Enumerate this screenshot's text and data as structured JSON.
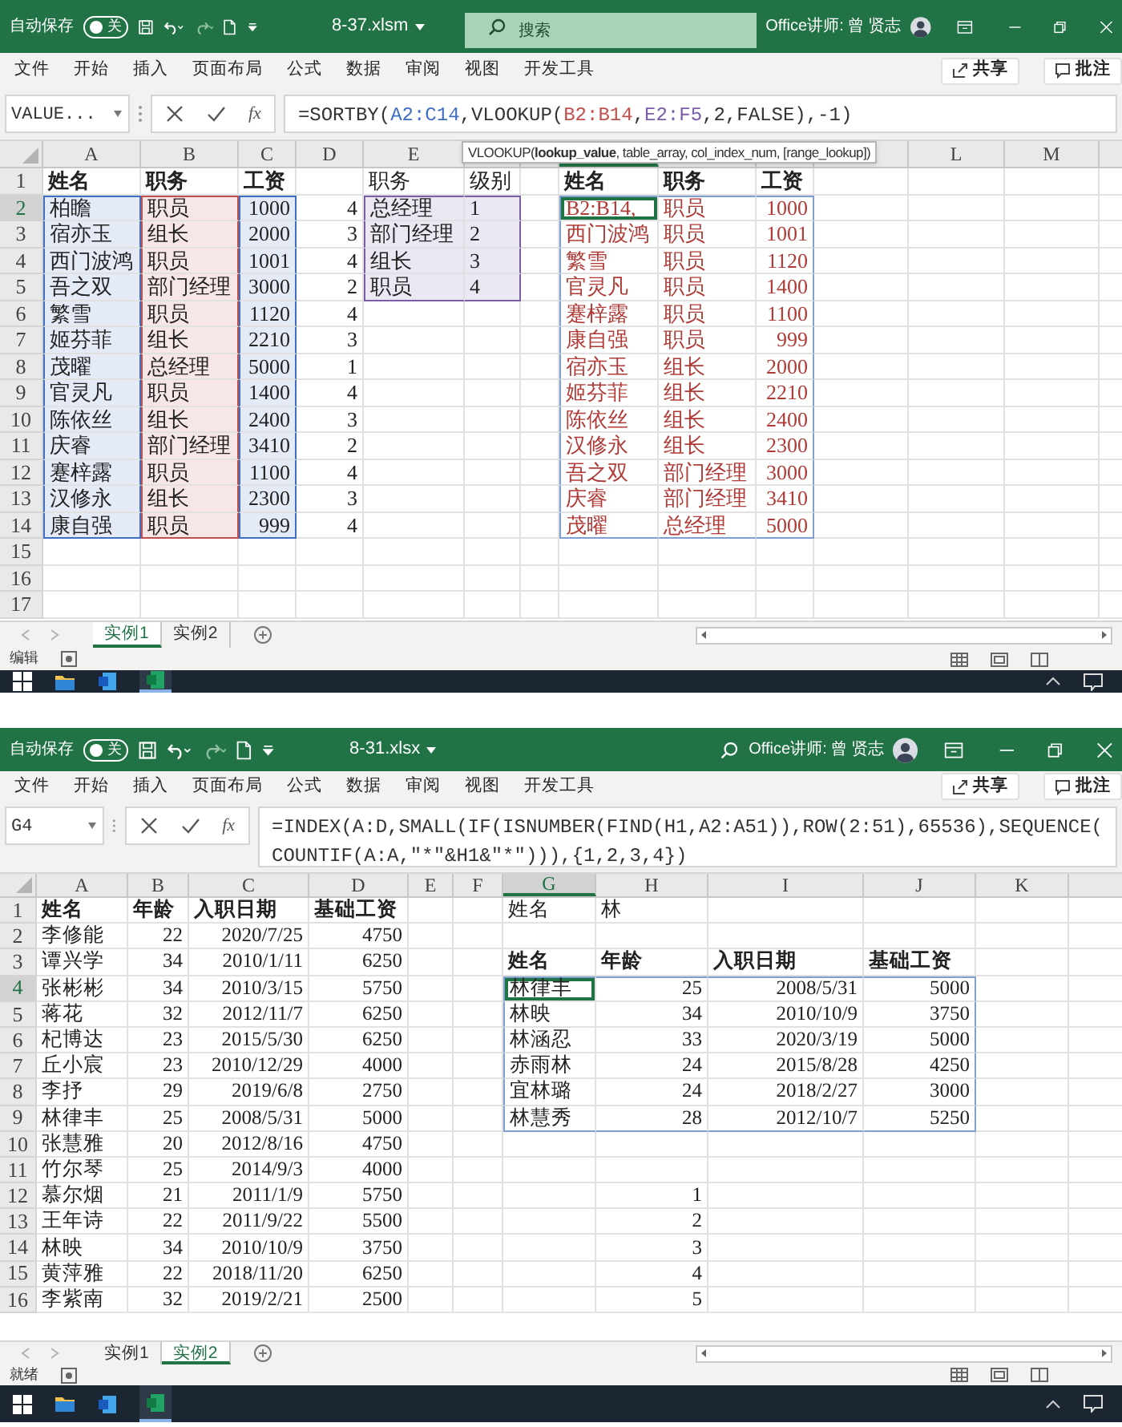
{
  "screens": [
    {
      "title_bar": {
        "autosave": "自动保存",
        "autosave_toggle": {
          "label": "关",
          "on": false
        },
        "filename": "8-37.xlsm",
        "search": {
          "placeholder": "搜索"
        },
        "user": "Office讲师: 曾 贤志"
      },
      "menu": [
        "文件",
        "开始",
        "插入",
        "页面布局",
        "公式",
        "数据",
        "审阅",
        "视图",
        "开发工具"
      ],
      "share": "共享",
      "comments": "批注",
      "name_box": "VALUE...",
      "insert_function": "fx",
      "formula_lines": [
        [
          {
            "text": "=SORTBY("
          },
          {
            "text": "A2:C14",
            "color": "#3f6fc0"
          },
          {
            "text": ",VLOOKUP("
          },
          {
            "text": "B2:B14",
            "color": "#c0504d"
          },
          {
            "text": ","
          },
          {
            "text": "E2:F5",
            "color": "#7b5ea7"
          },
          {
            "text": ",2,FALSE),-1)"
          }
        ]
      ],
      "tooltip": "VLOOKUP(**lookup_value**, table_array, col_index_num, [range_lookup])",
      "columns": [
        "A",
        "B",
        "C",
        "D",
        "E",
        null,
        null,
        null,
        null,
        null,
        null,
        "L",
        "M"
      ],
      "rows": [
        {
          "number": "1",
          "cells": [
            {
              "text": "姓名",
              "kind": "plain",
              "bold": true
            },
            {
              "text": "职务",
              "kind": "plain",
              "bold": true
            },
            {
              "text": "工资",
              "kind": "plain",
              "bold": true
            },
            null,
            {
              "text": "职务",
              "kind": "plain"
            },
            {
              "text": "级别",
              "kind": "plain"
            },
            null,
            {
              "text": "姓名",
              "kind": "plain",
              "bold": true
            },
            {
              "text": "职务",
              "kind": "plain",
              "bold": true
            },
            {
              "text": "工资",
              "kind": "plain",
              "bold": true
            }
          ]
        },
        {
          "number": "2",
          "cells": [
            {
              "text": "柏瞻",
              "kind": "reference",
              "color": "#3f6fc0"
            },
            {
              "text": "职员",
              "kind": "reference",
              "color": "#c0504d"
            },
            {
              "text": "1000",
              "kind": "reference",
              "color": "#3f6fc0",
              "number": true
            },
            {
              "text": "4",
              "kind": "plain",
              "number": true
            },
            {
              "text": "总经理",
              "kind": "reference",
              "color": "#7b5ea7"
            },
            {
              "text": "1",
              "kind": "reference",
              "color": "#7b5ea7"
            },
            null,
            {
              "text": "B2:B14,",
              "kind": "spill",
              "color": "#b03a36",
              "active": true
            },
            {
              "text": "职员",
              "kind": "spill",
              "color": "#b03a36"
            },
            {
              "text": "1000",
              "kind": "spill",
              "color": "#b03a36",
              "number": true
            }
          ]
        },
        {
          "number": "3",
          "cells": [
            {
              "text": "宿亦玉",
              "kind": "reference",
              "color": "#3f6fc0"
            },
            {
              "text": "组长",
              "kind": "reference",
              "color": "#c0504d"
            },
            {
              "text": "2000",
              "kind": "reference",
              "color": "#3f6fc0",
              "number": true
            },
            {
              "text": "3",
              "kind": "plain",
              "number": true
            },
            {
              "text": "部门经理",
              "kind": "reference",
              "color": "#7b5ea7"
            },
            {
              "text": "2",
              "kind": "reference",
              "color": "#7b5ea7"
            },
            null,
            {
              "text": "西门波鸿",
              "kind": "spill",
              "color": "#b03a36"
            },
            {
              "text": "职员",
              "kind": "spill",
              "color": "#b03a36"
            },
            {
              "text": "1001",
              "kind": "spill",
              "color": "#b03a36",
              "number": true
            }
          ]
        },
        {
          "number": "4",
          "cells": [
            {
              "text": "西门波鸿",
              "kind": "reference",
              "color": "#3f6fc0"
            },
            {
              "text": "职员",
              "kind": "reference",
              "color": "#c0504d"
            },
            {
              "text": "1001",
              "kind": "reference",
              "color": "#3f6fc0",
              "number": true
            },
            {
              "text": "4",
              "kind": "plain",
              "number": true
            },
            {
              "text": "组长",
              "kind": "reference",
              "color": "#7b5ea7"
            },
            {
              "text": "3",
              "kind": "reference",
              "color": "#7b5ea7"
            },
            null,
            {
              "text": "繁雪",
              "kind": "spill",
              "color": "#b03a36"
            },
            {
              "text": "职员",
              "kind": "spill",
              "color": "#b03a36"
            },
            {
              "text": "1120",
              "kind": "spill",
              "color": "#b03a36",
              "number": true
            }
          ]
        },
        {
          "number": "5",
          "cells": [
            {
              "text": "吾之双",
              "kind": "reference",
              "color": "#3f6fc0"
            },
            {
              "text": "部门经理",
              "kind": "reference",
              "color": "#c0504d"
            },
            {
              "text": "3000",
              "kind": "reference",
              "color": "#3f6fc0",
              "number": true
            },
            {
              "text": "2",
              "kind": "plain",
              "number": true
            },
            {
              "text": "职员",
              "kind": "reference",
              "color": "#7b5ea7"
            },
            {
              "text": "4",
              "kind": "reference",
              "color": "#7b5ea7"
            },
            null,
            {
              "text": "官灵凡",
              "kind": "spill",
              "color": "#b03a36"
            },
            {
              "text": "职员",
              "kind": "spill",
              "color": "#b03a36"
            },
            {
              "text": "1400",
              "kind": "spill",
              "color": "#b03a36",
              "number": true
            }
          ]
        },
        {
          "number": "6",
          "cells": [
            {
              "text": "繁雪",
              "kind": "reference",
              "color": "#3f6fc0"
            },
            {
              "text": "职员",
              "kind": "reference",
              "color": "#c0504d"
            },
            {
              "text": "1120",
              "kind": "reference",
              "color": "#3f6fc0",
              "number": true
            },
            {
              "text": "4",
              "kind": "plain",
              "number": true
            },
            null,
            null,
            null,
            {
              "text": "蹇梓露",
              "kind": "spill",
              "color": "#b03a36"
            },
            {
              "text": "职员",
              "kind": "spill",
              "color": "#b03a36"
            },
            {
              "text": "1100",
              "kind": "spill",
              "color": "#b03a36",
              "number": true
            }
          ]
        },
        {
          "number": "7",
          "cells": [
            {
              "text": "姬芬菲",
              "kind": "reference",
              "color": "#3f6fc0"
            },
            {
              "text": "组长",
              "kind": "reference",
              "color": "#c0504d"
            },
            {
              "text": "2210",
              "kind": "reference",
              "color": "#3f6fc0",
              "number": true
            },
            {
              "text": "3",
              "kind": "plain",
              "number": true
            },
            null,
            null,
            null,
            {
              "text": "康自强",
              "kind": "spill",
              "color": "#b03a36"
            },
            {
              "text": "职员",
              "kind": "spill",
              "color": "#b03a36"
            },
            {
              "text": "999",
              "kind": "spill",
              "color": "#b03a36",
              "number": true
            }
          ]
        },
        {
          "number": "8",
          "cells": [
            {
              "text": "茂曜",
              "kind": "reference",
              "color": "#3f6fc0"
            },
            {
              "text": "总经理",
              "kind": "reference",
              "color": "#c0504d"
            },
            {
              "text": "5000",
              "kind": "reference",
              "color": "#3f6fc0",
              "number": true
            },
            {
              "text": "1",
              "kind": "plain",
              "number": true
            },
            null,
            null,
            null,
            {
              "text": "宿亦玉",
              "kind": "spill",
              "color": "#b03a36"
            },
            {
              "text": "组长",
              "kind": "spill",
              "color": "#b03a36"
            },
            {
              "text": "2000",
              "kind": "spill",
              "color": "#b03a36",
              "number": true
            }
          ]
        },
        {
          "number": "9",
          "cells": [
            {
              "text": "官灵凡",
              "kind": "reference",
              "color": "#3f6fc0"
            },
            {
              "text": "职员",
              "kind": "reference",
              "color": "#c0504d"
            },
            {
              "text": "1400",
              "kind": "reference",
              "color": "#3f6fc0",
              "number": true
            },
            {
              "text": "4",
              "kind": "plain",
              "number": true
            },
            null,
            null,
            null,
            {
              "text": "姬芬菲",
              "kind": "spill",
              "color": "#b03a36"
            },
            {
              "text": "组长",
              "kind": "spill",
              "color": "#b03a36"
            },
            {
              "text": "2210",
              "kind": "spill",
              "color": "#b03a36",
              "number": true
            }
          ]
        },
        {
          "number": "10",
          "cells": [
            {
              "text": "陈依丝",
              "kind": "reference",
              "color": "#3f6fc0"
            },
            {
              "text": "组长",
              "kind": "reference",
              "color": "#c0504d"
            },
            {
              "text": "2400",
              "kind": "reference",
              "color": "#3f6fc0",
              "number": true
            },
            {
              "text": "3",
              "kind": "plain",
              "number": true
            },
            null,
            null,
            null,
            {
              "text": "陈依丝",
              "kind": "spill",
              "color": "#b03a36"
            },
            {
              "text": "组长",
              "kind": "spill",
              "color": "#b03a36"
            },
            {
              "text": "2400",
              "kind": "spill",
              "color": "#b03a36",
              "number": true
            }
          ]
        },
        {
          "number": "11",
          "cells": [
            {
              "text": "庆睿",
              "kind": "reference",
              "color": "#3f6fc0"
            },
            {
              "text": "部门经理",
              "kind": "reference",
              "color": "#c0504d"
            },
            {
              "text": "3410",
              "kind": "reference",
              "color": "#3f6fc0",
              "number": true
            },
            {
              "text": "2",
              "kind": "plain",
              "number": true
            },
            null,
            null,
            null,
            {
              "text": "汉修永",
              "kind": "spill",
              "color": "#b03a36"
            },
            {
              "text": "组长",
              "kind": "spill",
              "color": "#b03a36"
            },
            {
              "text": "2300",
              "kind": "spill",
              "color": "#b03a36",
              "number": true
            }
          ]
        },
        {
          "number": "12",
          "cells": [
            {
              "text": "蹇梓露",
              "kind": "reference",
              "color": "#3f6fc0"
            },
            {
              "text": "职员",
              "kind": "reference",
              "color": "#c0504d"
            },
            {
              "text": "1100",
              "kind": "reference",
              "color": "#3f6fc0",
              "number": true
            },
            {
              "text": "4",
              "kind": "plain",
              "number": true
            },
            null,
            null,
            null,
            {
              "text": "吾之双",
              "kind": "spill",
              "color": "#b03a36"
            },
            {
              "text": "部门经理",
              "kind": "spill",
              "color": "#b03a36"
            },
            {
              "text": "3000",
              "kind": "spill",
              "color": "#b03a36",
              "number": true
            }
          ]
        },
        {
          "number": "13",
          "cells": [
            {
              "text": "汉修永",
              "kind": "reference",
              "color": "#3f6fc0"
            },
            {
              "text": "组长",
              "kind": "reference",
              "color": "#c0504d"
            },
            {
              "text": "2300",
              "kind": "reference",
              "color": "#3f6fc0",
              "number": true
            },
            {
              "text": "3",
              "kind": "plain",
              "number": true
            },
            null,
            null,
            null,
            {
              "text": "庆睿",
              "kind": "spill",
              "color": "#b03a36"
            },
            {
              "text": "部门经理",
              "kind": "spill",
              "color": "#b03a36"
            },
            {
              "text": "3410",
              "kind": "spill",
              "color": "#b03a36",
              "number": true
            }
          ]
        },
        {
          "number": "14",
          "cells": [
            {
              "text": "康自强",
              "kind": "reference",
              "color": "#3f6fc0"
            },
            {
              "text": "职员",
              "kind": "reference",
              "color": "#c0504d"
            },
            {
              "text": "999",
              "kind": "reference",
              "color": "#3f6fc0",
              "number": true
            },
            {
              "text": "4",
              "kind": "plain",
              "number": true
            },
            null,
            null,
            null,
            {
              "text": "茂曜",
              "kind": "spill",
              "color": "#b03a36"
            },
            {
              "text": "总经理",
              "kind": "spill",
              "color": "#b03a36"
            },
            {
              "text": "5000",
              "kind": "spill",
              "color": "#b03a36",
              "number": true
            }
          ]
        },
        {
          "number": "15",
          "cells": []
        },
        {
          "number": "16",
          "cells": []
        },
        {
          "number": "17",
          "cells": []
        }
      ],
      "sheets": [
        {
          "label": "实例1",
          "selected": true
        },
        {
          "label": "实例2",
          "selected": false
        }
      ],
      "status": "编辑"
    },
    {
      "title_bar": {
        "autosave": "自动保存",
        "autosave_toggle": {
          "label": "关",
          "on": false
        },
        "filename": "8-31.xlsx",
        "user": "Office讲师: 曾 贤志"
      },
      "menu": [
        "文件",
        "开始",
        "插入",
        "页面布局",
        "公式",
        "数据",
        "审阅",
        "视图",
        "开发工具"
      ],
      "share": "共享",
      "comments": "批注",
      "name_box": "G4",
      "insert_function": "fx",
      "formula_lines": [
        [
          {
            "text": "=INDEX(A:D,SMALL(IF(ISNUMBER(FIND(H1,A2:A51)),ROW(2:51),65536),SEQUENCE("
          }
        ],
        [
          {
            "text": "COUNTIF(A:A,\"*\"&H1&\"*\"))),{1,2,3,4})"
          }
        ]
      ],
      "columns": [
        "A",
        "B",
        "C",
        "D",
        "E",
        "F",
        "G",
        "H",
        "I",
        "J",
        "K"
      ],
      "rows": [
        {
          "number": "1",
          "cells": [
            {
              "text": "姓名",
              "kind": "plain",
              "bold": true
            },
            {
              "text": "年龄",
              "kind": "plain",
              "bold": true
            },
            {
              "text": "入职日期",
              "kind": "plain",
              "bold": true
            },
            {
              "text": "基础工资",
              "kind": "plain",
              "bold": true
            },
            null,
            null,
            {
              "text": "姓名",
              "kind": "plain"
            },
            {
              "text": "林",
              "kind": "plain"
            }
          ]
        },
        {
          "number": "2",
          "cells": [
            {
              "text": "李修能",
              "kind": "plain"
            },
            {
              "text": "22",
              "kind": "plain",
              "number": true
            },
            {
              "text": "2020/7/25",
              "kind": "plain",
              "number": true
            },
            {
              "text": "4750",
              "kind": "plain",
              "number": true
            }
          ]
        },
        {
          "number": "3",
          "cells": [
            {
              "text": "谭兴学",
              "kind": "plain"
            },
            {
              "text": "34",
              "kind": "plain",
              "number": true
            },
            {
              "text": "2010/1/11",
              "kind": "plain",
              "number": true
            },
            {
              "text": "6250",
              "kind": "plain",
              "number": true
            },
            null,
            null,
            {
              "text": "姓名",
              "kind": "plain",
              "bold": true
            },
            {
              "text": "年龄",
              "kind": "plain",
              "bold": true
            },
            {
              "text": "入职日期",
              "kind": "plain",
              "bold": true
            },
            {
              "text": "基础工资",
              "kind": "plain",
              "bold": true
            }
          ]
        },
        {
          "number": "4",
          "cells": [
            {
              "text": "张彬彬",
              "kind": "plain"
            },
            {
              "text": "34",
              "kind": "plain",
              "number": true
            },
            {
              "text": "2010/3/15",
              "kind": "plain",
              "number": true
            },
            {
              "text": "5750",
              "kind": "plain",
              "number": true
            },
            null,
            null,
            {
              "text": "林律丰",
              "kind": "spill",
              "color": "#222222",
              "active": true
            },
            {
              "text": "25",
              "kind": "spill",
              "color": "#222222",
              "number": true
            },
            {
              "text": "2008/5/31",
              "kind": "spill",
              "color": "#222222",
              "number": true
            },
            {
              "text": "5000",
              "kind": "spill",
              "color": "#222222",
              "number": true
            }
          ]
        },
        {
          "number": "5",
          "cells": [
            {
              "text": "蒋花",
              "kind": "plain"
            },
            {
              "text": "32",
              "kind": "plain",
              "number": true
            },
            {
              "text": "2012/11/7",
              "kind": "plain",
              "number": true
            },
            {
              "text": "6250",
              "kind": "plain",
              "number": true
            },
            null,
            null,
            {
              "text": "林映",
              "kind": "spill",
              "color": "#222222"
            },
            {
              "text": "34",
              "kind": "spill",
              "color": "#222222",
              "number": true
            },
            {
              "text": "2010/10/9",
              "kind": "spill",
              "color": "#222222",
              "number": true
            },
            {
              "text": "3750",
              "kind": "spill",
              "color": "#222222",
              "number": true
            }
          ]
        },
        {
          "number": "6",
          "cells": [
            {
              "text": "杞博达",
              "kind": "plain"
            },
            {
              "text": "23",
              "kind": "plain",
              "number": true
            },
            {
              "text": "2015/5/30",
              "kind": "plain",
              "number": true
            },
            {
              "text": "6250",
              "kind": "plain",
              "number": true
            },
            null,
            null,
            {
              "text": "林涵忍",
              "kind": "spill",
              "color": "#222222"
            },
            {
              "text": "33",
              "kind": "spill",
              "color": "#222222",
              "number": true
            },
            {
              "text": "2020/3/19",
              "kind": "spill",
              "color": "#222222",
              "number": true
            },
            {
              "text": "5000",
              "kind": "spill",
              "color": "#222222",
              "number": true
            }
          ]
        },
        {
          "number": "7",
          "cells": [
            {
              "text": "丘小宸",
              "kind": "plain"
            },
            {
              "text": "23",
              "kind": "plain",
              "number": true
            },
            {
              "text": "2010/12/29",
              "kind": "plain",
              "number": true
            },
            {
              "text": "4000",
              "kind": "plain",
              "number": true
            },
            null,
            null,
            {
              "text": "赤雨林",
              "kind": "spill",
              "color": "#222222"
            },
            {
              "text": "24",
              "kind": "spill",
              "color": "#222222",
              "number": true
            },
            {
              "text": "2015/8/28",
              "kind": "spill",
              "color": "#222222",
              "number": true
            },
            {
              "text": "4250",
              "kind": "spill",
              "color": "#222222",
              "number": true
            }
          ]
        },
        {
          "number": "8",
          "cells": [
            {
              "text": "李抒",
              "kind": "plain"
            },
            {
              "text": "29",
              "kind": "plain",
              "number": true
            },
            {
              "text": "2019/6/8",
              "kind": "plain",
              "number": true
            },
            {
              "text": "2750",
              "kind": "plain",
              "number": true
            },
            null,
            null,
            {
              "text": "宜林璐",
              "kind": "spill",
              "color": "#222222"
            },
            {
              "text": "24",
              "kind": "spill",
              "color": "#222222",
              "number": true
            },
            {
              "text": "2018/2/27",
              "kind": "spill",
              "color": "#222222",
              "number": true
            },
            {
              "text": "3000",
              "kind": "spill",
              "color": "#222222",
              "number": true
            }
          ]
        },
        {
          "number": "9",
          "cells": [
            {
              "text": "林律丰",
              "kind": "plain"
            },
            {
              "text": "25",
              "kind": "plain",
              "number": true
            },
            {
              "text": "2008/5/31",
              "kind": "plain",
              "number": true
            },
            {
              "text": "5000",
              "kind": "plain",
              "number": true
            },
            null,
            null,
            {
              "text": "林慧秀",
              "kind": "spill",
              "color": "#222222"
            },
            {
              "text": "28",
              "kind": "spill",
              "color": "#222222",
              "number": true
            },
            {
              "text": "2012/10/7",
              "kind": "spill",
              "color": "#222222",
              "number": true
            },
            {
              "text": "5250",
              "kind": "spill",
              "color": "#222222",
              "number": true
            }
          ]
        },
        {
          "number": "10",
          "cells": [
            {
              "text": "张慧雅",
              "kind": "plain"
            },
            {
              "text": "20",
              "kind": "plain",
              "number": true
            },
            {
              "text": "2012/8/16",
              "kind": "plain",
              "number": true
            },
            {
              "text": "4750",
              "kind": "plain",
              "number": true
            }
          ]
        },
        {
          "number": "11",
          "cells": [
            {
              "text": "竹尔琴",
              "kind": "plain"
            },
            {
              "text": "25",
              "kind": "plain",
              "number": true
            },
            {
              "text": "2014/9/3",
              "kind": "plain",
              "number": true
            },
            {
              "text": "4000",
              "kind": "plain",
              "number": true
            }
          ]
        },
        {
          "number": "12",
          "cells": [
            {
              "text": "慕尔烟",
              "kind": "plain"
            },
            {
              "text": "21",
              "kind": "plain",
              "number": true
            },
            {
              "text": "2011/1/9",
              "kind": "plain",
              "number": true
            },
            {
              "text": "5750",
              "kind": "plain",
              "number": true
            },
            null,
            null,
            null,
            {
              "text": "1",
              "kind": "plain",
              "number": true
            }
          ]
        },
        {
          "number": "13",
          "cells": [
            {
              "text": "王年诗",
              "kind": "plain"
            },
            {
              "text": "22",
              "kind": "plain",
              "number": true
            },
            {
              "text": "2011/9/22",
              "kind": "plain",
              "number": true
            },
            {
              "text": "5500",
              "kind": "plain",
              "number": true
            },
            null,
            null,
            null,
            {
              "text": "2",
              "kind": "plain",
              "number": true
            }
          ]
        },
        {
          "number": "14",
          "cells": [
            {
              "text": "林映",
              "kind": "plain"
            },
            {
              "text": "34",
              "kind": "plain",
              "number": true
            },
            {
              "text": "2010/10/9",
              "kind": "plain",
              "number": true
            },
            {
              "text": "3750",
              "kind": "plain",
              "number": true
            },
            null,
            null,
            null,
            {
              "text": "3",
              "kind": "plain",
              "number": true
            }
          ]
        },
        {
          "number": "15",
          "cells": [
            {
              "text": "黄萍雅",
              "kind": "plain"
            },
            {
              "text": "22",
              "kind": "plain",
              "number": true
            },
            {
              "text": "2018/11/20",
              "kind": "plain",
              "number": true
            },
            {
              "text": "6250",
              "kind": "plain",
              "number": true
            },
            null,
            null,
            null,
            {
              "text": "4",
              "kind": "plain",
              "number": true
            }
          ]
        },
        {
          "number": "16",
          "cells": [
            {
              "text": "李紫南",
              "kind": "plain"
            },
            {
              "text": "32",
              "kind": "plain",
              "number": true
            },
            {
              "text": "2019/2/21",
              "kind": "plain",
              "number": true
            },
            {
              "text": "2500",
              "kind": "plain",
              "number": true
            },
            null,
            null,
            null,
            {
              "text": "5",
              "kind": "plain",
              "number": true
            }
          ]
        }
      ],
      "sheets": [
        {
          "label": "实例1",
          "selected": false
        },
        {
          "label": "实例2",
          "selected": true
        }
      ],
      "status": "就绪"
    }
  ]
}
